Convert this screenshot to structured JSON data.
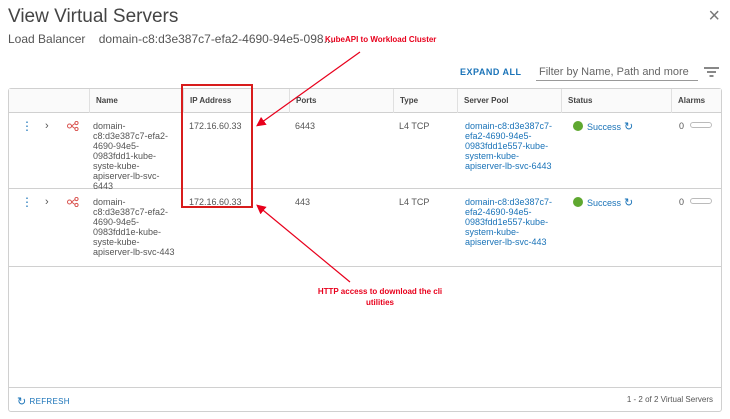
{
  "dialog": {
    "title": "View Virtual Servers",
    "close_glyph": "×",
    "lb_label": "Load Balancer",
    "lb_value": "domain-c8:d3e387c7-efa2-4690-94e5-098..."
  },
  "annotations": {
    "top": "KubeAPI to Workload Cluster",
    "bottom": "HTTP access to download the cli utilities",
    "color": "#e8001c"
  },
  "toolbar": {
    "expand_all": "EXPAND ALL",
    "filter_placeholder": "Filter by Name, Path and more",
    "filter_icon": "filter-lines-icon"
  },
  "table": {
    "headers": [
      "Name",
      "IP Address",
      "Ports",
      "Type",
      "Server Pool",
      "Status",
      "Alarms"
    ],
    "rows": [
      {
        "name": "domain-c8:d3e387c7-efa2-4690-94e5-0983fdd1-kube-syste-kube-apiserver-lb-svc-6443",
        "ip": "172.16.60.33",
        "ports": "6443",
        "type": "L4 TCP",
        "pool": "domain-c8:d3e387c7-efa2-4690-94e5-0983fdd1e557-kube-system-kube-apiserver-lb-svc-6443",
        "status": "Success",
        "alarms": "0"
      },
      {
        "name": "domain-c8:d3e387c7-efa2-4690-94e5-0983fdd1e-kube-syste-kube-apiserver-lb-svc-443",
        "ip": "172.16.60.33",
        "ports": "443",
        "type": "L4 TCP",
        "pool": "domain-c8:d3e387c7-efa2-4690-94e5-0983fdd1e557-kube-system-kube-apiserver-lb-svc-443",
        "status": "Success",
        "alarms": "0"
      }
    ]
  },
  "footer": {
    "refresh": "REFRESH",
    "count": "1 - 2 of 2 Virtual Servers"
  },
  "colors": {
    "accent": "#1a73b8",
    "success": "#5fa830",
    "highlight_box": "#d81c1c"
  }
}
